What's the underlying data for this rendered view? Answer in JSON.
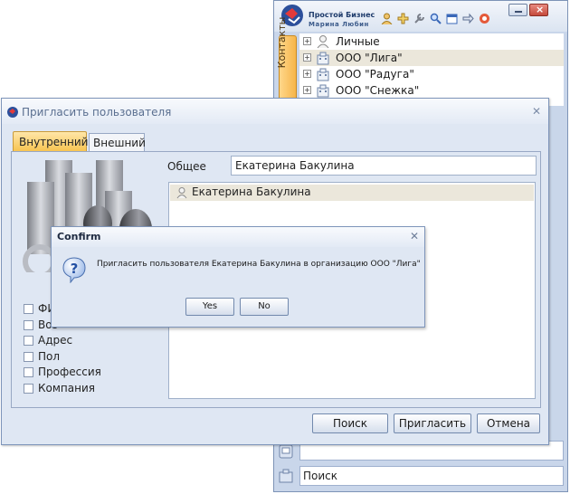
{
  "back_window": {
    "app_title": "Простой Бизнес",
    "app_user": "Марина Любин",
    "toolbar_icons": [
      "user-icon",
      "add-icon",
      "wrench-icon",
      "search-icon",
      "calendar-icon",
      "forward-icon",
      "lifebuoy-icon"
    ],
    "side_tab": "Контакты",
    "tree": [
      {
        "label": "Личные",
        "icon": "person-icon",
        "selected": false
      },
      {
        "label": "ООО \"Лига\"",
        "icon": "building-icon",
        "selected": true
      },
      {
        "label": "ООО \"Радуга\"",
        "icon": "building-icon",
        "selected": false
      },
      {
        "label": "ООО \"Снежка\"",
        "icon": "building-icon",
        "selected": false
      }
    ],
    "search_label": "Поиск"
  },
  "dialog": {
    "title": "Пригласить пользователя",
    "tabs": [
      "Внутренний",
      "Внешний"
    ],
    "general_label": "Общее",
    "general_value": "Екатерина Бакулина",
    "result_item": "Екатерина Бакулина",
    "checkboxes": [
      "ФИ",
      "Воз",
      "Адрес",
      "Пол",
      "Профессия",
      "Компания"
    ],
    "buttons": {
      "search": "Поиск",
      "invite": "Пригласить",
      "cancel": "Отмена"
    }
  },
  "confirm": {
    "title": "Confirm",
    "message": "Пригласить пользователя Екатерина Бакулина в организацию ООО \"Лига\"",
    "yes": "Yes",
    "no": "No"
  },
  "colors": {
    "accent_tab": "#f7c452",
    "selection": "#ebe7db",
    "window_frame": "#7e95ba",
    "panel_bg": "#dfe7f3"
  }
}
